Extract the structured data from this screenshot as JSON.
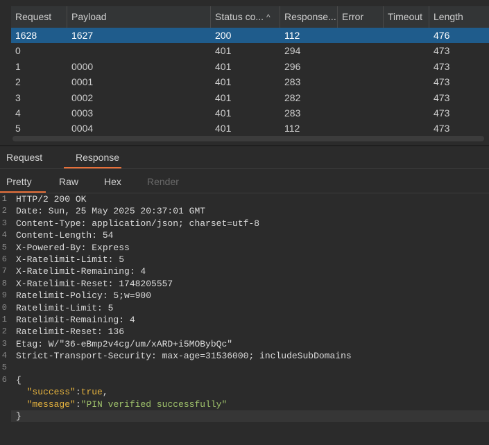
{
  "table": {
    "headers": {
      "request": "Request",
      "payload": "Payload",
      "status": "Status co...",
      "response": "Response...",
      "error": "Error",
      "timeout": "Timeout",
      "length": "Length"
    },
    "rows": [
      {
        "request": "1628",
        "payload": "1627",
        "status": "200",
        "response": "112",
        "error": "",
        "timeout": "",
        "length": "476"
      },
      {
        "request": "0",
        "payload": "",
        "status": "401",
        "response": "294",
        "error": "",
        "timeout": "",
        "length": "473"
      },
      {
        "request": "1",
        "payload": "0000",
        "status": "401",
        "response": "296",
        "error": "",
        "timeout": "",
        "length": "473"
      },
      {
        "request": "2",
        "payload": "0001",
        "status": "401",
        "response": "283",
        "error": "",
        "timeout": "",
        "length": "473"
      },
      {
        "request": "3",
        "payload": "0002",
        "status": "401",
        "response": "282",
        "error": "",
        "timeout": "",
        "length": "473"
      },
      {
        "request": "4",
        "payload": "0003",
        "status": "401",
        "response": "283",
        "error": "",
        "timeout": "",
        "length": "473"
      },
      {
        "request": "5",
        "payload": "0004",
        "status": "401",
        "response": "112",
        "error": "",
        "timeout": "",
        "length": "473"
      }
    ]
  },
  "tabs": {
    "request": "Request",
    "response": "Response"
  },
  "view_tabs": {
    "pretty": "Pretty",
    "raw": "Raw",
    "hex": "Hex",
    "render": "Render"
  },
  "editor": {
    "gutter": [
      "1",
      "2",
      "3",
      "4",
      "5",
      "6",
      "7",
      "8",
      "9",
      "0",
      "1",
      "2",
      "3",
      "4",
      "5",
      "6",
      "",
      "",
      ""
    ],
    "lines": [
      "HTTP/2 200 OK",
      "Date: Sun, 25 May 2025 20:37:01 GMT",
      "Content-Type: application/json; charset=utf-8",
      "Content-Length: 54",
      "X-Powered-By: Express",
      "X-Ratelimit-Limit: 5",
      "X-Ratelimit-Remaining: 4",
      "X-Ratelimit-Reset: 1748205557",
      "Ratelimit-Policy: 5;w=900",
      "Ratelimit-Limit: 5",
      "Ratelimit-Remaining: 4",
      "Ratelimit-Reset: 136",
      "Etag: W/\"36-eBmp2v4cg/um/xARD+i5MOBybQc\"",
      "Strict-Transport-Security: max-age=31536000; includeSubDomains",
      ""
    ],
    "json": {
      "open": "{",
      "success_key": "\"success\"",
      "success_val": "true",
      "message_key": "\"message\"",
      "message_val": "\"PIN verified successfully\"",
      "close": "}"
    }
  }
}
